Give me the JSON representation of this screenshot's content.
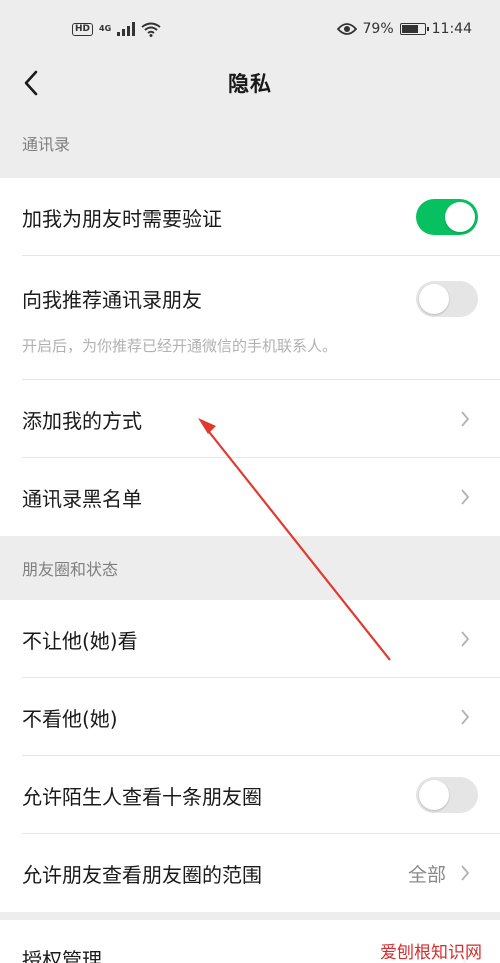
{
  "status_bar": {
    "hd_label": "HD",
    "network_label": "4G",
    "battery_text": "79%",
    "battery_level": 0.79,
    "time": "11:44",
    "icons": [
      "signal-icon",
      "wifi-icon",
      "eye-icon",
      "battery-icon"
    ]
  },
  "nav": {
    "title": "隐私",
    "back_icon": "back-arrow-icon"
  },
  "sections": {
    "contacts": {
      "header": "通讯录",
      "items": [
        {
          "label": "加我为朋友时需要验证",
          "toggle": "on"
        },
        {
          "label": "向我推荐通讯录朋友",
          "toggle": "off",
          "hint": "开启后，为你推荐已经开通微信的手机联系人。"
        },
        {
          "label": "添加我的方式"
        },
        {
          "label": "通讯录黑名单"
        }
      ]
    },
    "moments": {
      "header": "朋友圈和状态",
      "items": [
        {
          "label": "不让他(她)看"
        },
        {
          "label": "不看他(她)"
        },
        {
          "label": "允许陌生人查看十条朋友圈",
          "toggle": "off"
        },
        {
          "label": "允许朋友查看朋友圈的范围",
          "value": "全部"
        }
      ]
    },
    "auth": {
      "items": [
        {
          "label": "授权管理"
        }
      ]
    }
  },
  "colors": {
    "toggle_on": "#07c160",
    "toggle_off": "#e5e5e5",
    "annotation_arrow": "#e03a2f",
    "background": "#ededed"
  },
  "watermark": "爱刨根知识网"
}
